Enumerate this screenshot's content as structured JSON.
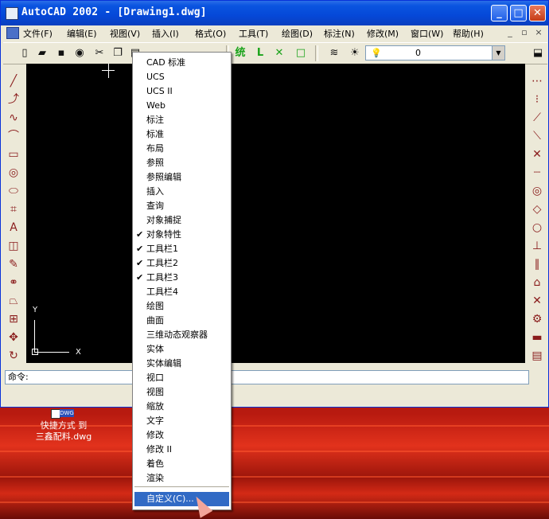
{
  "window": {
    "title": "AutoCAD 2002 - [Drawing1.dwg]",
    "controls": {
      "minimize": "_",
      "maximize": "□",
      "close": "✕"
    }
  },
  "menubar": {
    "items": [
      {
        "label": "文件(F)"
      },
      {
        "label": "编辑(E)"
      },
      {
        "label": "视图(V)"
      },
      {
        "label": "插入(I)"
      },
      {
        "label": "格式(O)"
      },
      {
        "label": "工具(T)"
      },
      {
        "label": "绘图(D)"
      },
      {
        "label": "标注(N)"
      },
      {
        "label": "修改(M)"
      },
      {
        "label": "窗口(W)"
      },
      {
        "label": "帮助(H)"
      }
    ],
    "mdi": {
      "minimize": "_",
      "restore": "▫",
      "close": "×"
    }
  },
  "toolbar": {
    "icons": [
      {
        "name": "new-icon",
        "glyph": "▯"
      },
      {
        "name": "open-icon",
        "glyph": "▰"
      },
      {
        "name": "save-icon",
        "glyph": "▪"
      },
      {
        "name": "plot-icon",
        "glyph": "◉"
      },
      {
        "name": "cut-icon",
        "glyph": "✂"
      },
      {
        "name": "copy-icon",
        "glyph": "❐"
      },
      {
        "name": "paste-icon",
        "glyph": "▤"
      }
    ],
    "draft_icons": [
      {
        "name": "ortho-icon",
        "glyph": "L"
      },
      {
        "name": "x-icon",
        "glyph": "✕"
      },
      {
        "name": "square-icon",
        "glyph": "□"
      }
    ],
    "layer_value": "0",
    "glyph_text": "统"
  },
  "left_tools": [
    {
      "name": "line-icon",
      "glyph": "╱"
    },
    {
      "name": "polyline-icon",
      "glyph": "⤴"
    },
    {
      "name": "spline-icon",
      "glyph": "∿"
    },
    {
      "name": "arc-icon",
      "glyph": "⌒"
    },
    {
      "name": "rectangle-icon",
      "glyph": "▭"
    },
    {
      "name": "circle-icon",
      "glyph": "◎"
    },
    {
      "name": "ellipse-icon",
      "glyph": "⬭"
    },
    {
      "name": "hatch-icon",
      "glyph": "⌗"
    },
    {
      "name": "text-icon",
      "glyph": "A"
    },
    {
      "name": "block-icon",
      "glyph": "◫"
    },
    {
      "name": "erase-icon",
      "glyph": "✎"
    },
    {
      "name": "copy-object-icon",
      "glyph": "⚭"
    },
    {
      "name": "mirror-icon",
      "glyph": "⏢"
    },
    {
      "name": "array-icon",
      "glyph": "⊞"
    },
    {
      "name": "move-icon",
      "glyph": "✥"
    },
    {
      "name": "rotate-icon",
      "glyph": "↻"
    }
  ],
  "right_tools": [
    {
      "name": "dim-linear-icon",
      "glyph": "⋯"
    },
    {
      "name": "dim-aligned-icon",
      "glyph": "⁝"
    },
    {
      "name": "snap-endpoint-icon",
      "glyph": "⟋"
    },
    {
      "name": "snap-midpoint-icon",
      "glyph": "⟍"
    },
    {
      "name": "snap-intersection-icon",
      "glyph": "✕"
    },
    {
      "name": "snap-extension-icon",
      "glyph": "┈"
    },
    {
      "name": "snap-center-icon",
      "glyph": "◎"
    },
    {
      "name": "snap-quadrant-icon",
      "glyph": "◇"
    },
    {
      "name": "snap-tangent-icon",
      "glyph": "○"
    },
    {
      "name": "snap-perpendicular-icon",
      "glyph": "⊥"
    },
    {
      "name": "snap-parallel-icon",
      "glyph": "∥"
    },
    {
      "name": "snap-insert-icon",
      "glyph": "⌂"
    },
    {
      "name": "snap-none-icon",
      "glyph": "✕"
    },
    {
      "name": "snap-settings-icon",
      "glyph": "⚙"
    },
    {
      "name": "color-icon",
      "glyph": "▬"
    },
    {
      "name": "layer-icon",
      "glyph": "▤"
    }
  ],
  "ucs": {
    "y_label": "Y",
    "x_label": "X"
  },
  "command": {
    "prompt": "命令:"
  },
  "context_menu": {
    "items": [
      {
        "label": "CAD 标准",
        "checked": false
      },
      {
        "label": "UCS",
        "checked": false
      },
      {
        "label": "UCS II",
        "checked": false
      },
      {
        "label": "Web",
        "checked": false
      },
      {
        "label": "标注",
        "checked": false
      },
      {
        "label": "标准",
        "checked": false
      },
      {
        "label": "布局",
        "checked": false
      },
      {
        "label": "参照",
        "checked": false
      },
      {
        "label": "参照编辑",
        "checked": false
      },
      {
        "label": "插入",
        "checked": false
      },
      {
        "label": "查询",
        "checked": false
      },
      {
        "label": "对象捕捉",
        "checked": false
      },
      {
        "label": "对象特性",
        "checked": true
      },
      {
        "label": "工具栏1",
        "checked": true
      },
      {
        "label": "工具栏2",
        "checked": true
      },
      {
        "label": "工具栏3",
        "checked": true
      },
      {
        "label": "工具栏4",
        "checked": false
      },
      {
        "label": "绘图",
        "checked": false
      },
      {
        "label": "曲面",
        "checked": false
      },
      {
        "label": "三维动态观察器",
        "checked": false
      },
      {
        "label": "实体",
        "checked": false
      },
      {
        "label": "实体编辑",
        "checked": false
      },
      {
        "label": "视口",
        "checked": false
      },
      {
        "label": "视图",
        "checked": false
      },
      {
        "label": "缩放",
        "checked": false
      },
      {
        "label": "文字",
        "checked": false
      },
      {
        "label": "修改",
        "checked": false
      },
      {
        "label": "修改 II",
        "checked": false
      },
      {
        "label": "着色",
        "checked": false
      },
      {
        "label": "渲染",
        "checked": false
      }
    ],
    "customize": {
      "label": "自定义(C)..."
    },
    "check_glyph": "✔"
  },
  "desktop": {
    "shortcut": {
      "line1": "快捷方式 到",
      "line2": "三鑫配料.dwg",
      "badge": "DWG"
    }
  }
}
